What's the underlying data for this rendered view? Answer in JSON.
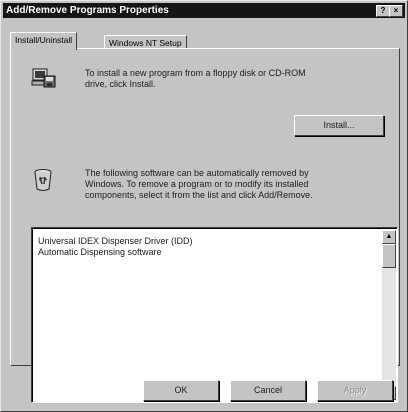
{
  "window": {
    "title": "Add/Remove Programs Properties",
    "help_button": "?",
    "close_button": "×"
  },
  "tabs": [
    {
      "label": "Install/Uninstall",
      "active": true
    },
    {
      "label": "Windows NT Setup",
      "active": false
    }
  ],
  "install": {
    "icon": "floppy-computer-icon",
    "text_line1": "To install a new program from a floppy disk or CD-ROM",
    "text_line2": "drive, click Install.",
    "button_label": "Install..."
  },
  "uninstall": {
    "icon": "recycle-bin-icon",
    "text_line1": "The following software can be automatically removed by",
    "text_line2": "Windows. To remove a program or to modify its installed",
    "text_line3": "components, select it from the list and click Add/Remove."
  },
  "program_list": {
    "items": [
      "Universal IDEX Dispenser Driver (IDD)",
      "Automatic Dispensing software"
    ]
  },
  "buttons": {
    "ok": "OK",
    "cancel": "Cancel",
    "apply": "Apply"
  },
  "colors": {
    "face": "#c4c4c4",
    "titlebar": "#151515"
  }
}
